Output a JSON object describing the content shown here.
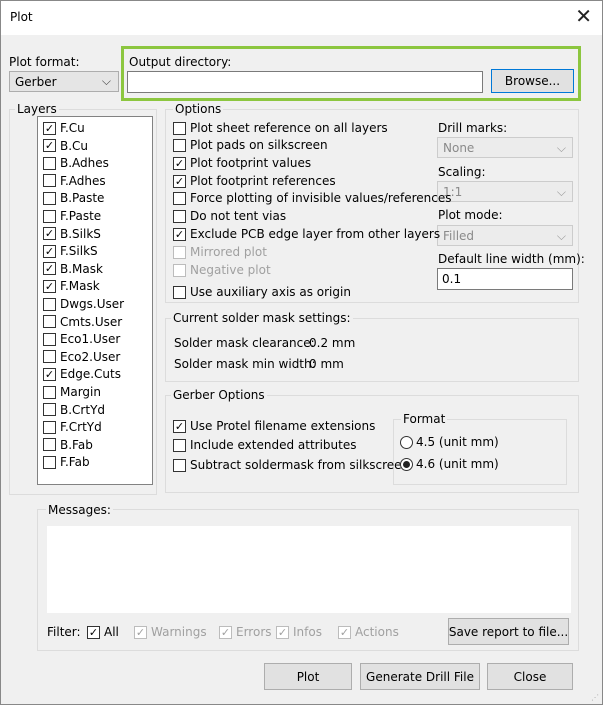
{
  "window": {
    "title": "Plot",
    "close_glyph": "✕"
  },
  "plot_format": {
    "label": "Plot format:",
    "value": "Gerber"
  },
  "output_dir": {
    "label": "Output directory:",
    "value": "",
    "browse": "Browse...",
    "highlight_color": "#8cc63f"
  },
  "layers": {
    "title": "Layers",
    "items": [
      {
        "label": "F.Cu",
        "checked": true
      },
      {
        "label": "B.Cu",
        "checked": true
      },
      {
        "label": "B.Adhes",
        "checked": false
      },
      {
        "label": "F.Adhes",
        "checked": false
      },
      {
        "label": "B.Paste",
        "checked": false
      },
      {
        "label": "F.Paste",
        "checked": false
      },
      {
        "label": "B.SilkS",
        "checked": true
      },
      {
        "label": "F.SilkS",
        "checked": true
      },
      {
        "label": "B.Mask",
        "checked": true
      },
      {
        "label": "F.Mask",
        "checked": true
      },
      {
        "label": "Dwgs.User",
        "checked": false
      },
      {
        "label": "Cmts.User",
        "checked": false
      },
      {
        "label": "Eco1.User",
        "checked": false
      },
      {
        "label": "Eco2.User",
        "checked": false
      },
      {
        "label": "Edge.Cuts",
        "checked": true
      },
      {
        "label": "Margin",
        "checked": false
      },
      {
        "label": "B.CrtYd",
        "checked": false
      },
      {
        "label": "F.CrtYd",
        "checked": false
      },
      {
        "label": "B.Fab",
        "checked": false
      },
      {
        "label": "F.Fab",
        "checked": false
      }
    ]
  },
  "options": {
    "title": "Options",
    "items": [
      {
        "label": "Plot sheet reference on all layers",
        "checked": false,
        "disabled": false
      },
      {
        "label": "Plot pads on silkscreen",
        "checked": false,
        "disabled": false
      },
      {
        "label": "Plot footprint values",
        "checked": true,
        "disabled": false
      },
      {
        "label": "Plot footprint references",
        "checked": true,
        "disabled": false
      },
      {
        "label": "Force plotting of invisible values/references",
        "checked": false,
        "disabled": false
      },
      {
        "label": "Do not tent vias",
        "checked": false,
        "disabled": false
      },
      {
        "label": "Exclude PCB edge layer from other layers",
        "checked": true,
        "disabled": false
      },
      {
        "label": "Mirrored plot",
        "checked": false,
        "disabled": true
      },
      {
        "label": "Negative plot",
        "checked": false,
        "disabled": true
      },
      {
        "label": "Use auxiliary axis as origin",
        "checked": false,
        "disabled": false
      }
    ],
    "drill_marks": {
      "label": "Drill marks:",
      "value": "None"
    },
    "scaling": {
      "label": "Scaling:",
      "value": "1:1"
    },
    "plot_mode": {
      "label": "Plot mode:",
      "value": "Filled"
    },
    "line_width": {
      "label": "Default line width (mm):",
      "value": "0.1"
    }
  },
  "solder_mask": {
    "title": "Current solder mask settings:",
    "clearance_label": "Solder mask clearance:",
    "clearance_value": "0.2 mm",
    "min_width_label": "Solder mask min width:",
    "min_width_value": "0 mm"
  },
  "gerber": {
    "title": "Gerber Options",
    "items": [
      {
        "label": "Use Protel filename extensions",
        "checked": true
      },
      {
        "label": "Include extended attributes",
        "checked": false
      },
      {
        "label": "Subtract soldermask from silkscreen",
        "checked": false
      }
    ],
    "format": {
      "title": "Format",
      "options": [
        {
          "label": "4.5 (unit mm)",
          "selected": false
        },
        {
          "label": "4.6 (unit mm)",
          "selected": true
        }
      ]
    }
  },
  "messages": {
    "title": "Messages:"
  },
  "filter": {
    "label": "Filter:",
    "items": [
      {
        "label": "All",
        "checked": true,
        "disabled": false
      },
      {
        "label": "Warnings",
        "checked": true,
        "disabled": true
      },
      {
        "label": "Errors",
        "checked": true,
        "disabled": true
      },
      {
        "label": "Infos",
        "checked": true,
        "disabled": true
      },
      {
        "label": "Actions",
        "checked": true,
        "disabled": true
      }
    ],
    "save_report": "Save report to file..."
  },
  "buttons": {
    "plot": "Plot",
    "drill": "Generate Drill File",
    "close": "Close"
  }
}
